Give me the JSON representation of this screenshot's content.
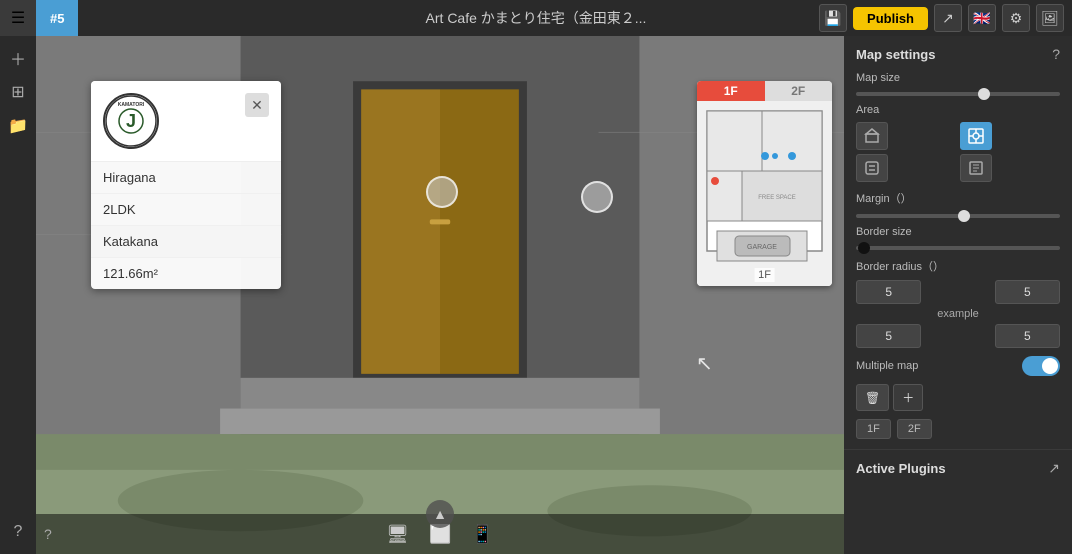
{
  "topbar": {
    "hamburger_icon": "☰",
    "tab_number": "#5",
    "title": "Art Cafe かまとり住宅（金田東２...",
    "publish_label": "Publish",
    "share_icon": "share",
    "language_icon": "🇬🇧",
    "settings_icon": "⚙",
    "image_icon": "🖼"
  },
  "sidebar": {
    "items": [
      {
        "icon": "+",
        "name": "add"
      },
      {
        "icon": "⊞",
        "name": "grid"
      },
      {
        "icon": "📁",
        "name": "folder"
      }
    ],
    "bottom_icon": {
      "icon": "?",
      "name": "help"
    }
  },
  "info_card": {
    "logo_text": "J",
    "close_label": "✕",
    "rows": [
      {
        "label": "Hiragana",
        "active": false
      },
      {
        "label": "2LDK",
        "active": false
      },
      {
        "label": "Katakana",
        "active": true
      },
      {
        "label": "121.66m²",
        "active": false
      }
    ]
  },
  "minimap": {
    "tab_1f": "1F",
    "tab_2f": "2F",
    "floor_label": "1F",
    "active_tab": "1F"
  },
  "right_panel": {
    "title": "Map settings",
    "help_icon": "?",
    "map_size_label": "Map size",
    "map_size_value": 65,
    "area_label": "Area",
    "area_buttons": [
      {
        "icon": "🏠",
        "name": "area-btn-1",
        "active": false
      },
      {
        "icon": "📡",
        "name": "area-btn-2",
        "active": true
      },
      {
        "icon": "📞",
        "name": "area-btn-3",
        "active": false
      },
      {
        "icon": "📋",
        "name": "area-btn-4",
        "active": false
      }
    ],
    "margin_label": "Margin（）",
    "margin_value": 55,
    "border_size_label": "Border size",
    "border_size_value": 5,
    "border_radius_label": "Border radius（）",
    "border_radius_values": [
      5,
      5,
      5,
      5
    ],
    "border_radius_example": "example",
    "multiple_map_label": "Multiple map",
    "multiple_map_enabled": true,
    "floor_tabs": [
      "1F",
      "2F"
    ],
    "delete_icon": "🗑",
    "add_icon": "+"
  },
  "active_plugins": {
    "title": "Active Plugins",
    "expand_icon": "↗"
  }
}
